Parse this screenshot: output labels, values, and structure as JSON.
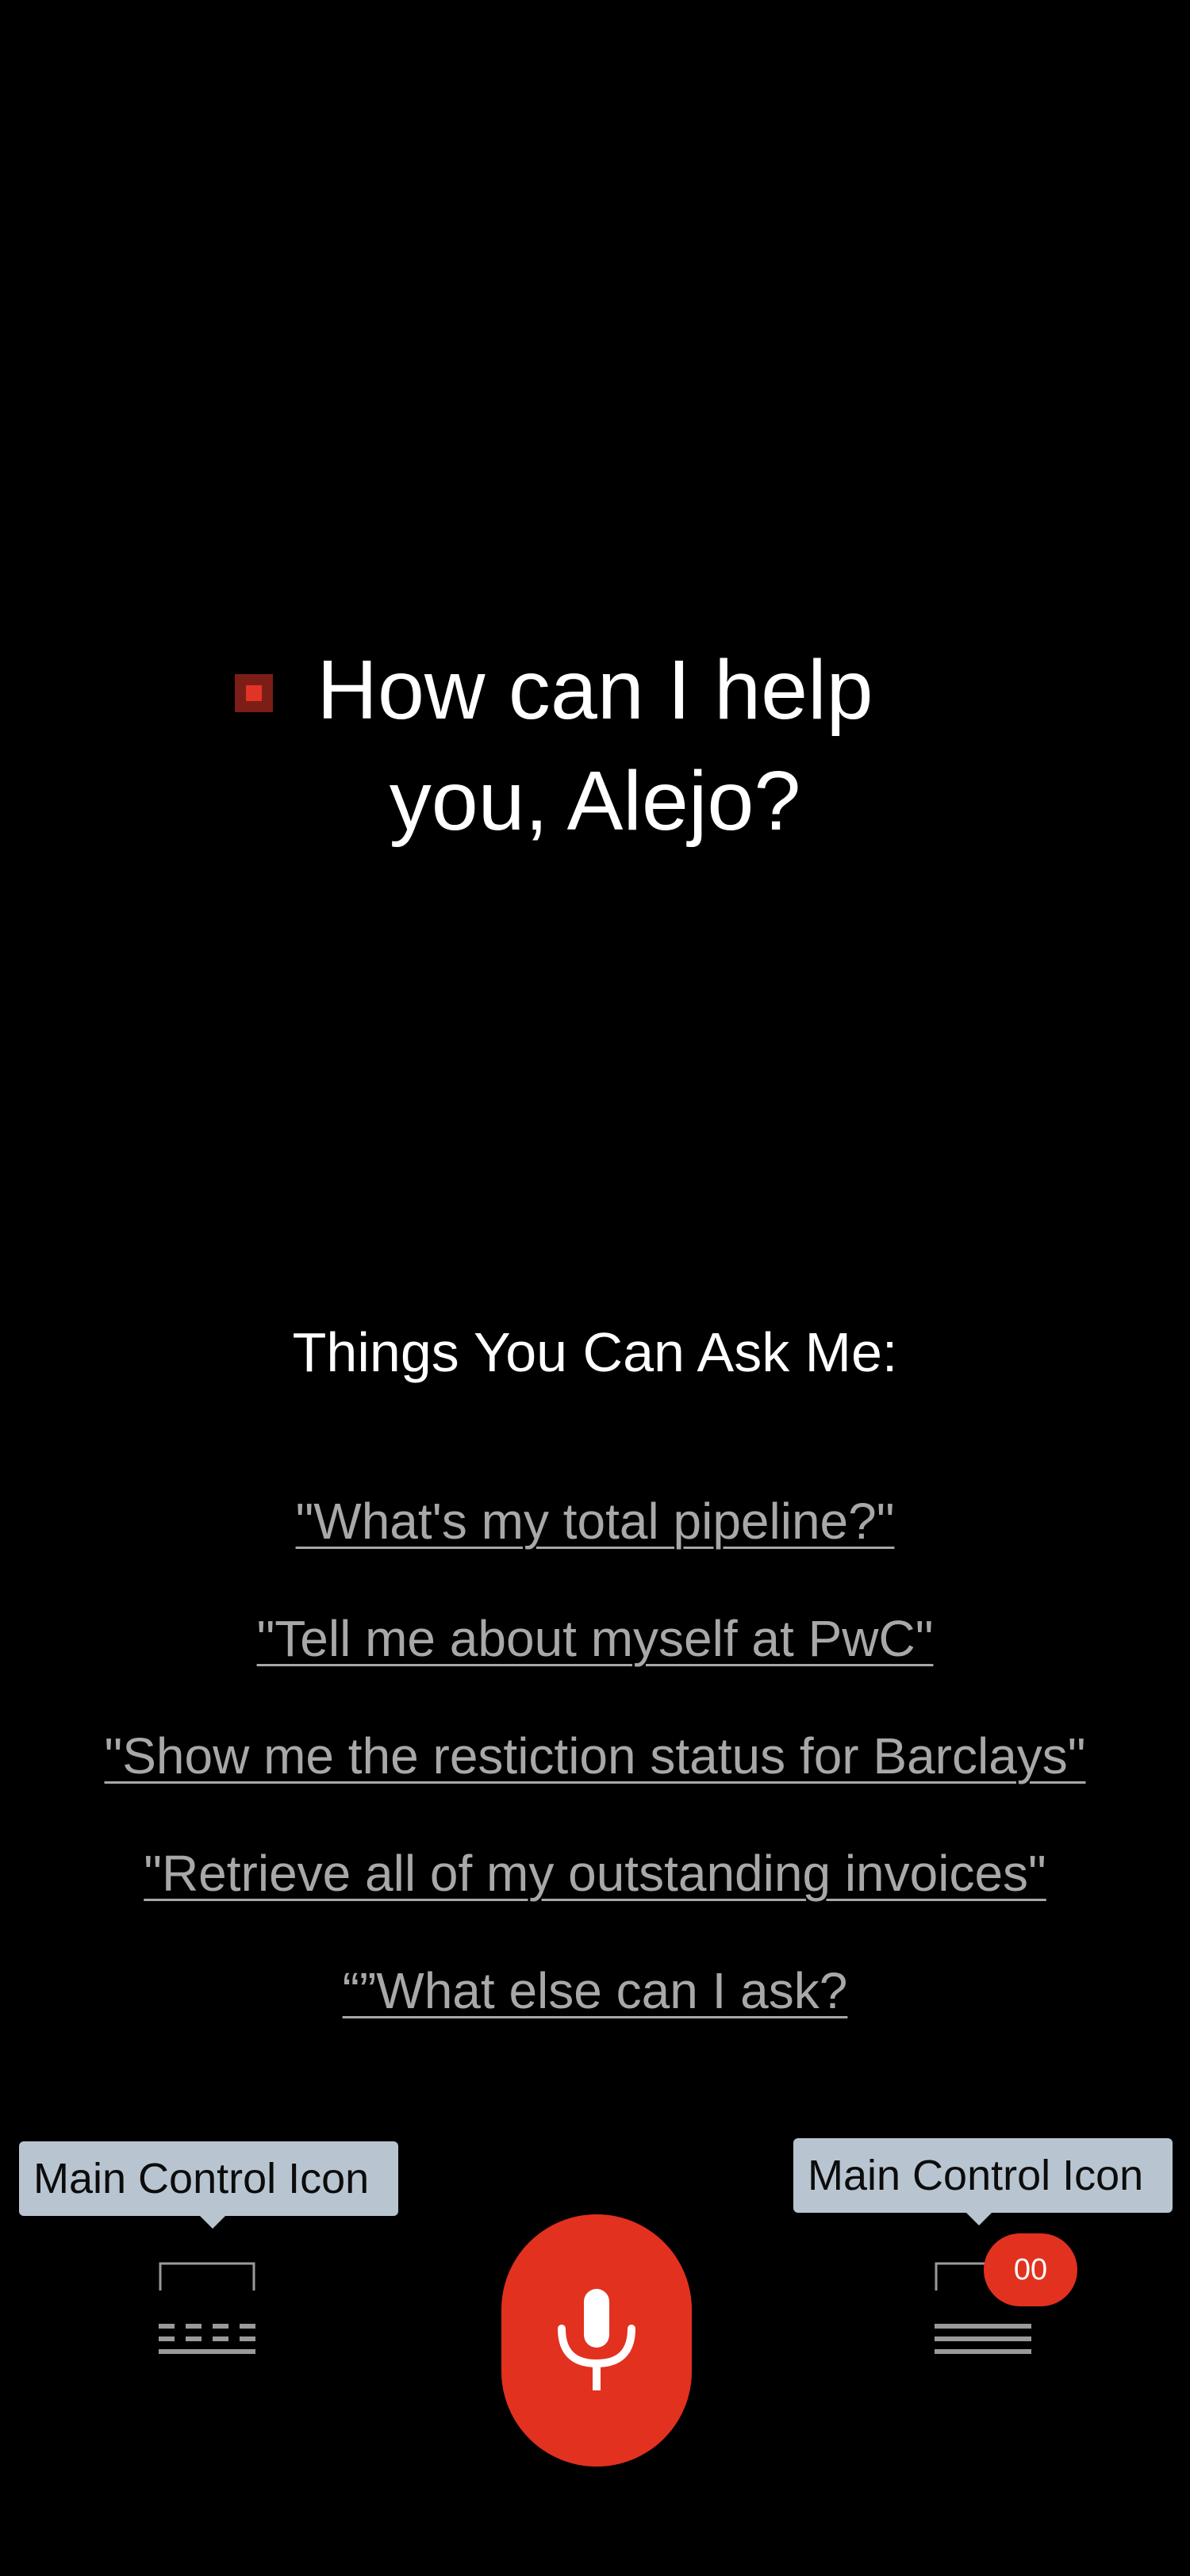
{
  "greeting": {
    "line1": "How can I help",
    "line2": "you, Alejo?"
  },
  "suggestions": {
    "heading": "Things You Can Ask Me:",
    "items": [
      "\"What's my total pipeline?\"",
      "\"Tell me about myself at PwC\"",
      "\"Show me the restiction status for Barclays\"",
      "\"Retrieve all of my outstanding invoices\"",
      "“”What else can I ask?"
    ]
  },
  "tooltips": {
    "left": "Main Control Icon",
    "right": "Main Control Icon"
  },
  "controls": {
    "left_icon": "keyboard-icon",
    "center_icon": "microphone-icon",
    "right_icon": "menu-icon",
    "badge_count": "00"
  },
  "colors": {
    "background": "#000000",
    "accent": "#e2311f",
    "link": "#a8a8a8",
    "tooltip": "#b8c5d1"
  }
}
